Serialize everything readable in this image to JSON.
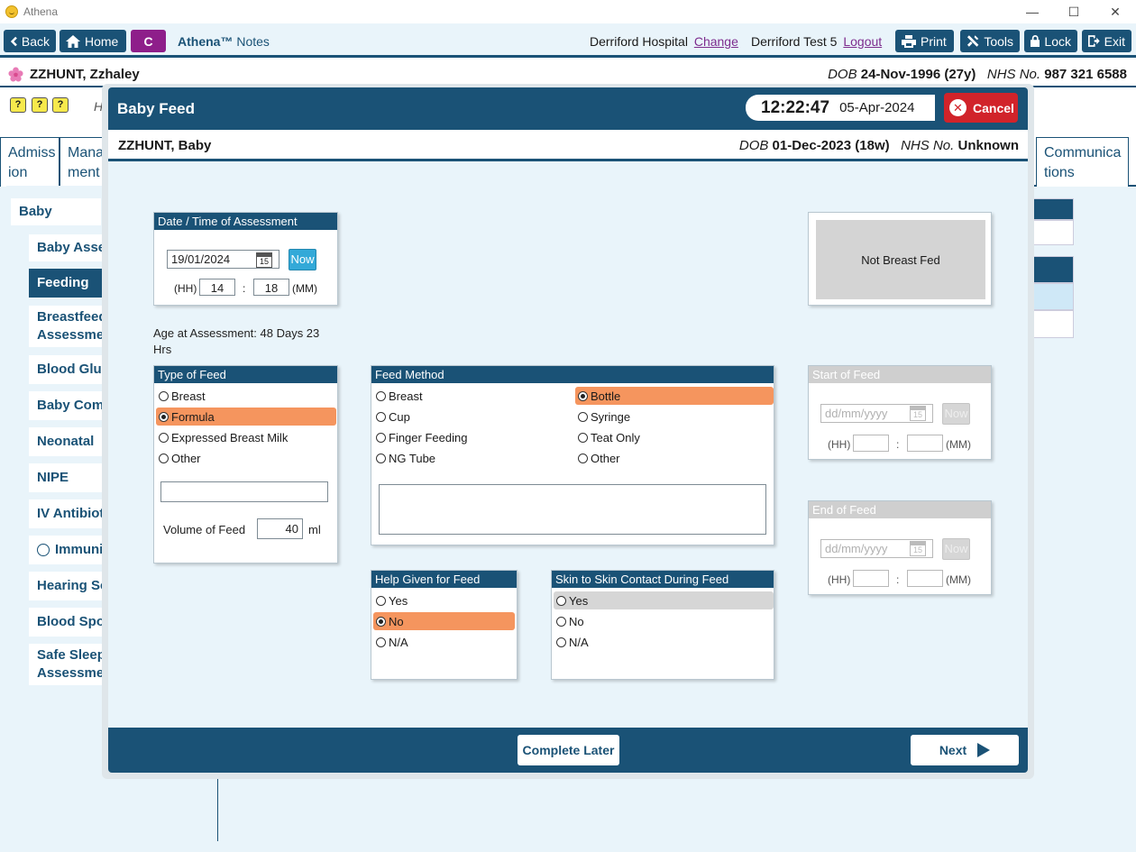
{
  "window": {
    "title": "Athena"
  },
  "toolbar": {
    "back": "Back",
    "home": "Home",
    "c": "C",
    "brand": "Athena™",
    "brand_sub": "Notes",
    "hospital": "Derriford Hospital",
    "change": "Change",
    "user": "Derriford Test 5",
    "logout": "Logout",
    "print": "Print",
    "tools": "Tools",
    "lock": "Lock",
    "exit": "Exit"
  },
  "patient": {
    "name": "ZZHUNT, Zzhaley",
    "dob_label": "DOB",
    "dob": "24-Nov-1996 (27y)",
    "nhs_label": "NHS No.",
    "nhs": "987 321 6588"
  },
  "background": {
    "heading_fragment": "H",
    "tabs": [
      "Admiss ion",
      "Mana ment",
      "Communica tions"
    ],
    "sidebar": [
      "Baby",
      "Baby Asses",
      "Feeding",
      "Breastfeedi Assessment",
      "Blood Gluc",
      "Baby Comr",
      "Neonatal",
      "NIPE",
      "IV Antibiot",
      "Immunis",
      "Hearing Sc",
      "Blood Spot",
      "Safe Sleepi Assessment"
    ]
  },
  "modal": {
    "title": "Baby Feed",
    "time": "12:22:47",
    "date": "05-Apr-2024",
    "cancel": "Cancel",
    "baby_name": "ZZHUNT, Baby",
    "dob_label": "DOB",
    "dob": "01-Dec-2023 (18w)",
    "nhs_label": "NHS No.",
    "nhs": "Unknown",
    "assessment": {
      "header": "Date / Time of Assessment",
      "date": "19/01/2024",
      "now": "Now",
      "hh_label": "(HH)",
      "hh": "14",
      "sep": ":",
      "mm": "18",
      "mm_label": "(MM)"
    },
    "not_breast_fed": "Not Breast Fed",
    "age_text": "Age at Assessment: 48 Days  23 Hrs",
    "type_of_feed": {
      "header": "Type of Feed",
      "options": [
        "Breast",
        "Formula",
        "Expressed Breast Milk",
        "Other"
      ],
      "selected": "Formula",
      "other_value": "",
      "volume_label": "Volume of Feed",
      "volume": "40",
      "unit": "ml"
    },
    "feed_method": {
      "header": "Feed Method",
      "options": [
        "Breast",
        "Bottle",
        "Cup",
        "Syringe",
        "Finger Feeding",
        "Teat Only",
        "NG Tube",
        "Other"
      ],
      "selected": "Bottle",
      "other_value": ""
    },
    "start_of_feed": {
      "header": "Start of Feed",
      "date_placeholder": "dd/mm/yyyy",
      "now": "Now",
      "hh_label": "(HH)",
      "sep": ":",
      "mm_label": "(MM)"
    },
    "end_of_feed": {
      "header": "End of Feed",
      "date_placeholder": "dd/mm/yyyy",
      "now": "Now",
      "hh_label": "(HH)",
      "sep": ":",
      "mm_label": "(MM)"
    },
    "help_given": {
      "header": "Help Given for Feed",
      "options": [
        "Yes",
        "No",
        "N/A"
      ],
      "selected": "No"
    },
    "skin_to_skin": {
      "header": "Skin to Skin Contact During Feed",
      "options": [
        "Yes",
        "No",
        "N/A"
      ],
      "hovered": "Yes"
    },
    "complete_later": "Complete Later",
    "next": "Next"
  },
  "colors": {
    "navy": "#1a5276",
    "selected_orange": "#f5955e",
    "cancel_red": "#d1232a",
    "c_purple": "#8e1e8a",
    "now_blue": "#33a9d8",
    "page_bg": "#e9f4fa"
  },
  "icons": [
    "athena-logo-icon",
    "back-chevron-icon",
    "home-icon",
    "printer-icon",
    "tools-icon",
    "lock-icon",
    "exit-icon",
    "flower-icon",
    "calendar-icon",
    "close-icon",
    "next-arrow-icon",
    "help-icon"
  ]
}
